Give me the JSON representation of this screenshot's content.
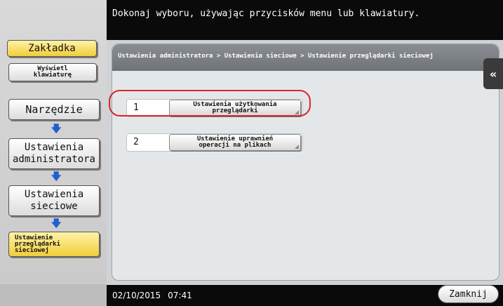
{
  "header": {
    "message": "Dokonaj wyboru, używając przycisków menu lub klawiatury."
  },
  "sidebar": {
    "bookmark_label": "Zakładka",
    "keyboard_label": "Wyświetl klawiaturę",
    "path": [
      "Narzędzie",
      "Ustawienia administratora",
      "Ustawienia sieciowe",
      "Ustawienie przeglądarki sieciowej"
    ],
    "arrow_icon": "down-arrow-icon"
  },
  "main": {
    "breadcrumb": "Ustawienia administratora > Ustawienia sieciowe > Ustawienie przeglądarki sieciowej",
    "collapse_icon": "double-chevron-left-icon",
    "options": [
      {
        "number": "1",
        "label": "Ustawienia użytkowania przeglądarki"
      },
      {
        "number": "2",
        "label": "Ustawienie uprawnień operacji na plikach"
      }
    ]
  },
  "footer": {
    "date": "02/10/2015",
    "time": "07:41",
    "close_label": "Zamknij"
  },
  "colors": {
    "accent_yellow": "#f0cd3a",
    "arrow_blue": "#1f5fd0",
    "highlight_red": "#d9262c"
  }
}
